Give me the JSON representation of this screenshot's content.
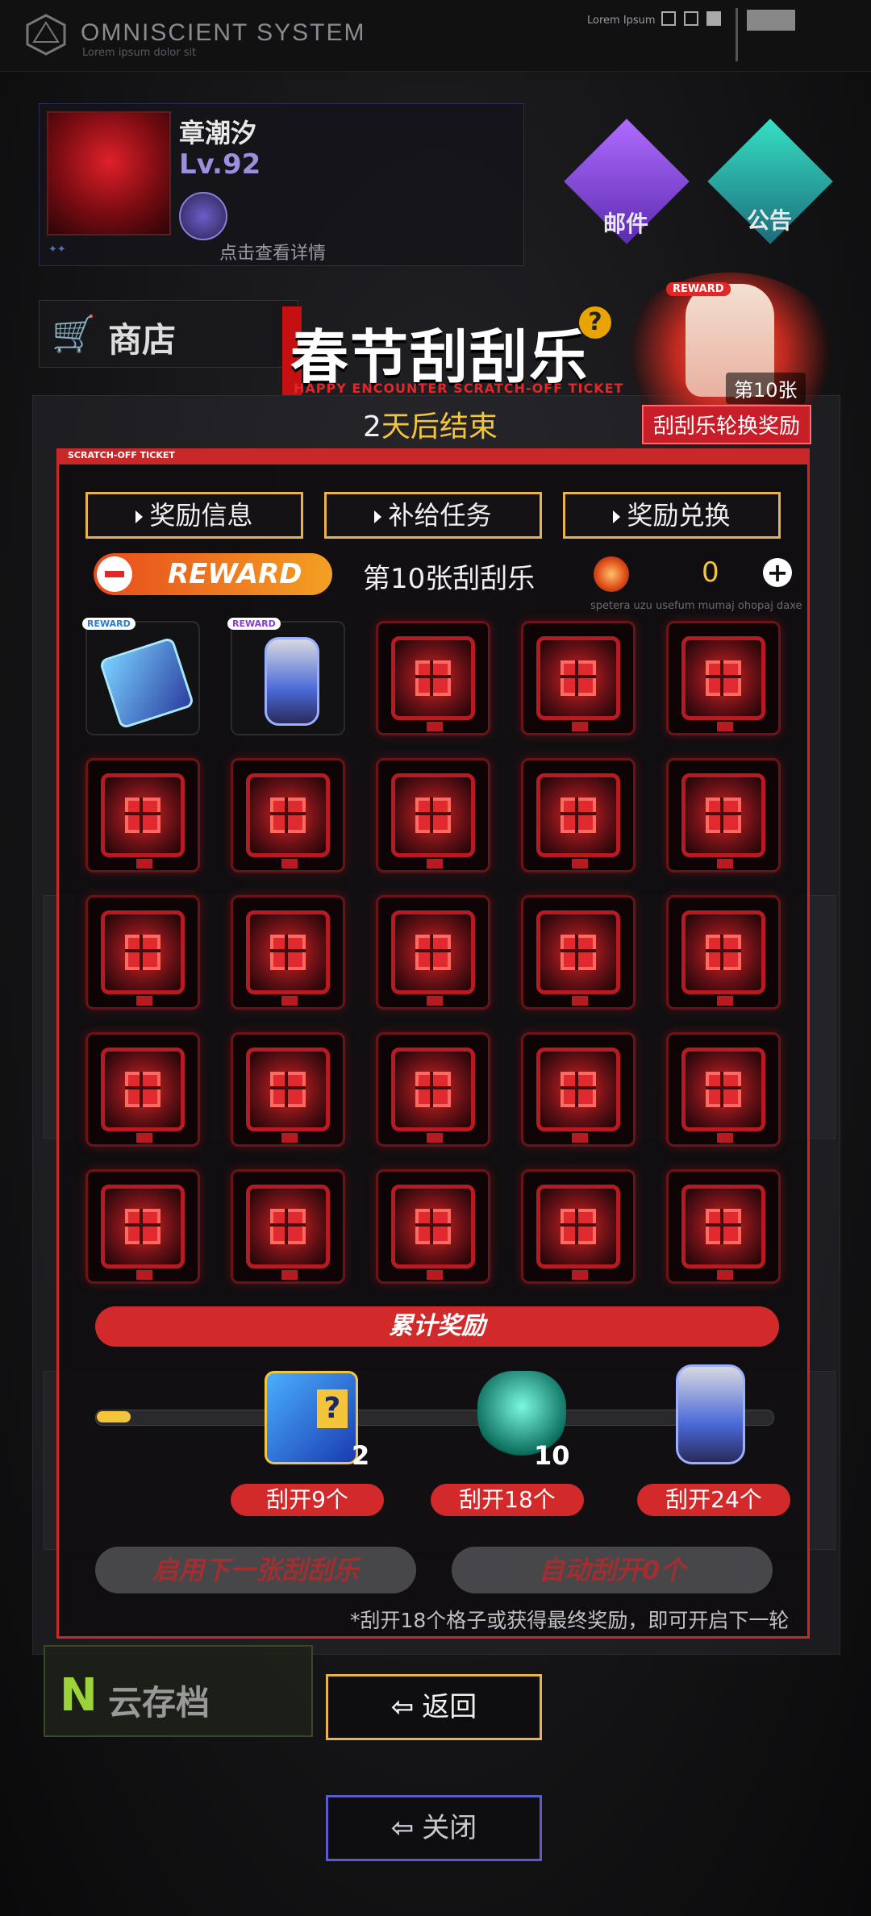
{
  "header": {
    "system_title": "OMNISCIENT  SYSTEM",
    "system_sub": "Lorem ipsum dolor sit",
    "lorem_top": "Lorem Ipsum"
  },
  "profile": {
    "name": "章潮汐",
    "level": "Lv.92",
    "detail": "点击查看详情"
  },
  "buttons": {
    "mail": "邮件",
    "notice": "公告",
    "shop": "商店"
  },
  "event": {
    "title": "春节刮刮乐",
    "subtitle": "HAPPY ENCOUNTER SCRATCH-OFF TICKET",
    "countdown_num": "2",
    "countdown_text": "天后结束",
    "help_icon": "?"
  },
  "rotating_reward": {
    "tag": "REWARD",
    "count": "第10张",
    "label": "刮刮乐轮换奖励"
  },
  "panel": {
    "header": "SCRATCH-OFF TICKET",
    "tabs": [
      "奖励信息",
      "补给任务",
      "奖励兑换"
    ],
    "reward_badge": "REWARD",
    "ticket_no": "第10张刮刮乐",
    "currency_value": "0",
    "currency_plus": "+",
    "lorem_small": "spetera uzu usefum mumaj ohopaj daxe"
  },
  "grid": {
    "cells": [
      {
        "state": "open",
        "tag": "REWARD",
        "item": "chip-icon"
      },
      {
        "state": "open",
        "tag": "REWARD",
        "item": "backpack-icon"
      },
      {
        "state": "locked"
      },
      {
        "state": "locked"
      },
      {
        "state": "locked"
      },
      {
        "state": "locked"
      },
      {
        "state": "locked"
      },
      {
        "state": "locked"
      },
      {
        "state": "locked"
      },
      {
        "state": "locked"
      },
      {
        "state": "locked"
      },
      {
        "state": "locked"
      },
      {
        "state": "locked"
      },
      {
        "state": "locked"
      },
      {
        "state": "locked"
      },
      {
        "state": "locked"
      },
      {
        "state": "locked"
      },
      {
        "state": "locked"
      },
      {
        "state": "locked"
      },
      {
        "state": "locked"
      },
      {
        "state": "locked"
      },
      {
        "state": "locked"
      },
      {
        "state": "locked"
      },
      {
        "state": "locked"
      },
      {
        "state": "locked"
      }
    ]
  },
  "cumulative": {
    "title": "累计奖励",
    "progress_fraction": 0.05,
    "milestones": [
      {
        "count": "2",
        "label": "刮开9个",
        "icon": "mystery-box-icon"
      },
      {
        "count": "10",
        "label": "刮开18个",
        "icon": "mask-icon"
      },
      {
        "count": "",
        "label": "刮开24个",
        "icon": "backpack-icon"
      }
    ],
    "next_ticket": "启用下一张刮刮乐",
    "auto_scratch": "自动刮开0个",
    "footnote": "*刮开18个格子或获得最终奖励，即可开启下一轮"
  },
  "bottom": {
    "back": "返回",
    "close": "关闭",
    "cloud_save": "云存档"
  },
  "colors": {
    "accent_red": "#c82828",
    "accent_gold": "#e8b34a",
    "highlight_yellow": "#f4c43a"
  }
}
